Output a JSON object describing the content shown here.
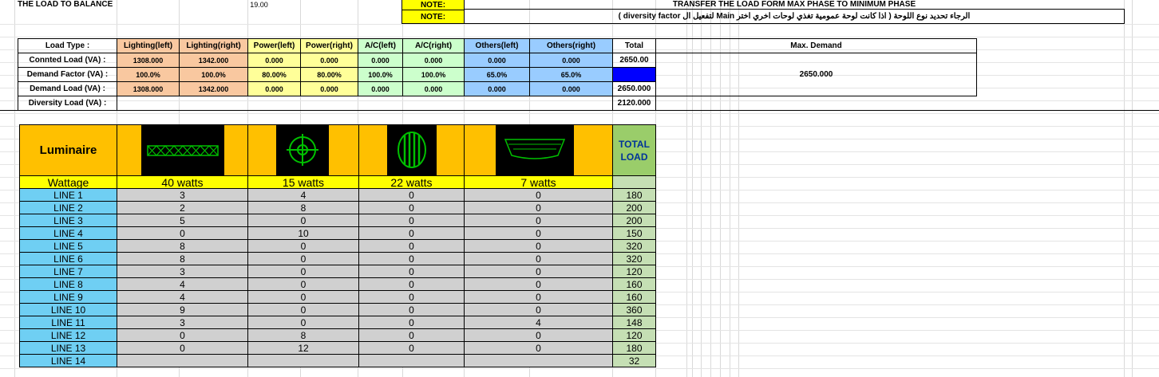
{
  "top": {
    "balance_label": "THE LOAD TO BALANCE",
    "balance_value": "19.00",
    "note_label_1": "NOTE:",
    "note_text_1": "TRANSFER THE LOAD FORM MAX PHASE TO MINIMUM PHASE",
    "note_label_2": "NOTE:",
    "note_text_2": "الرجاء تحديد نوع اللوحة ( اذا كانت لوحة عمومية تغذي لوحات اخري اختر Main لتفعيل ال diversity factor )"
  },
  "load_table": {
    "headers": [
      "Load Type :",
      "Lighting(left)",
      "Lighting(right)",
      "Power(left)",
      "Power(right)",
      "A/C(left)",
      "A/C(right)",
      "Others(left)",
      "Others(right)",
      "Total",
      "Max. Demand"
    ],
    "rows": [
      {
        "label": "Connted Load (VA) :",
        "values": [
          "1308.000",
          "1342.000",
          "0.000",
          "0.000",
          "0.000",
          "0.000",
          "0.000",
          "0.000"
        ],
        "total": "2650.00"
      },
      {
        "label": "Demand Factor (VA) :",
        "values": [
          "100.0%",
          "100.0%",
          "80.00%",
          "80.00%",
          "100.0%",
          "100.0%",
          "65.0%",
          "65.0%"
        ],
        "total": ""
      },
      {
        "label": "Demand Load (VA) :",
        "values": [
          "1308.000",
          "1342.000",
          "0.000",
          "0.000",
          "0.000",
          "0.000",
          "0.000",
          "0.000"
        ],
        "total": "2650.000"
      }
    ],
    "diversity_label": "Diversity Load (VA) :",
    "diversity_total": "2120.000",
    "max_demand_value": "2650.000"
  },
  "luminaire": {
    "title": "Luminaire",
    "total_header": "TOTAL LOAD",
    "wattage_label": "Wattage",
    "wattages": [
      "40 watts",
      "15 watts",
      "22 watts",
      "7 watts"
    ],
    "icons": [
      "fluorescent-tube-icon",
      "round-downlight-icon",
      "wall-light-icon",
      "ceiling-light-icon"
    ],
    "lines": [
      {
        "name": "LINE 1",
        "v": [
          "3",
          "4",
          "0",
          "0"
        ],
        "total": "180"
      },
      {
        "name": "LINE 2",
        "v": [
          "2",
          "8",
          "0",
          "0"
        ],
        "total": "200"
      },
      {
        "name": "LINE 3",
        "v": [
          "5",
          "0",
          "0",
          "0"
        ],
        "total": "200"
      },
      {
        "name": "LINE 4",
        "v": [
          "0",
          "10",
          "0",
          "0"
        ],
        "total": "150"
      },
      {
        "name": "LINE 5",
        "v": [
          "8",
          "0",
          "0",
          "0"
        ],
        "total": "320"
      },
      {
        "name": "LINE 6",
        "v": [
          "8",
          "0",
          "0",
          "0"
        ],
        "total": "320"
      },
      {
        "name": "LINE 7",
        "v": [
          "3",
          "0",
          "0",
          "0"
        ],
        "total": "120"
      },
      {
        "name": "LINE 8",
        "v": [
          "4",
          "0",
          "0",
          "0"
        ],
        "total": "160"
      },
      {
        "name": "LINE 9",
        "v": [
          "4",
          "0",
          "0",
          "0"
        ],
        "total": "160"
      },
      {
        "name": "LINE 10",
        "v": [
          "9",
          "0",
          "0",
          "0"
        ],
        "total": "360"
      },
      {
        "name": "LINE 11",
        "v": [
          "3",
          "0",
          "0",
          "4"
        ],
        "total": "148"
      },
      {
        "name": "LINE 12",
        "v": [
          "0",
          "8",
          "0",
          "0"
        ],
        "total": "120"
      },
      {
        "name": "LINE 13",
        "v": [
          "0",
          "12",
          "0",
          "0"
        ],
        "total": "180"
      },
      {
        "name": "LINE 14",
        "v": [
          "",
          "",
          "",
          ""
        ],
        "total": "32"
      }
    ]
  },
  "colors": {
    "lighting": "#f9c8a0",
    "power": "#ffff99",
    "ac": "#ccffcc",
    "others": "#99ccff",
    "line_label": "#6fcff3",
    "data_cell": "#d0d0d0",
    "luminaire_header": "#ffc000",
    "wattage_row": "#ffff00",
    "total_col": "#c5dfb4",
    "icon_bg": "#000000",
    "icon_stroke": "#00c000"
  }
}
